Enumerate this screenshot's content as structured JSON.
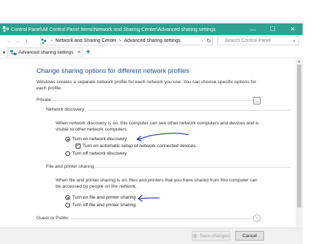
{
  "window": {
    "title": "Control Panel\\All Control Panel Items\\Network and Sharing Center\\Advanced sharing settings",
    "minimize_glyph": "—",
    "maximize_glyph": "☐",
    "close_glyph": "✕",
    "titlebar_color": "#2ea18f"
  },
  "addressbar": {
    "back_glyph": "←",
    "forward_glyph": "→",
    "up_glyph": "↑",
    "crumbs": [
      "Network and Sharing Center",
      "Advanced sharing settings"
    ],
    "crumb_separator": ">",
    "search_placeholder": "Search Control Panel"
  },
  "tabs": [
    {
      "label": "Advanced sharing settings",
      "close_glyph": "×"
    }
  ],
  "newtab_glyph": "+",
  "content": {
    "heading": "Change sharing options for different network profiles",
    "intro": "Windows creates a separate network profile for each network you use. You can choose specific options for each profile.",
    "private": {
      "label": "Private",
      "network_discovery": {
        "label": "Network discovery",
        "description": "When network discovery is on, this computer can see other network computers and devices and is visible to other network computers.",
        "options": [
          {
            "label": "Turn on network discovery",
            "selected": true
          },
          {
            "label": "Turn on automatic setup of network connected devices.",
            "checked": true
          },
          {
            "label": "Turn off network discovery",
            "selected": false
          }
        ]
      },
      "file_printer_sharing": {
        "label": "File and printer sharing",
        "description": "When file and printer sharing is on, files and printers that you have shared from this computer can be accessed by people on the network.",
        "options": [
          {
            "label": "Turn on file and printer sharing",
            "selected": true
          },
          {
            "label": "Turn off file and printer sharing",
            "selected": false
          }
        ]
      }
    },
    "guest_public": {
      "label": "Guest or Public"
    }
  },
  "buttons": {
    "save": "Save changes",
    "cancel": "Cancel"
  },
  "colors": {
    "heading": "#1d4d8f",
    "annotation_arrow": "#1f3fbf"
  }
}
